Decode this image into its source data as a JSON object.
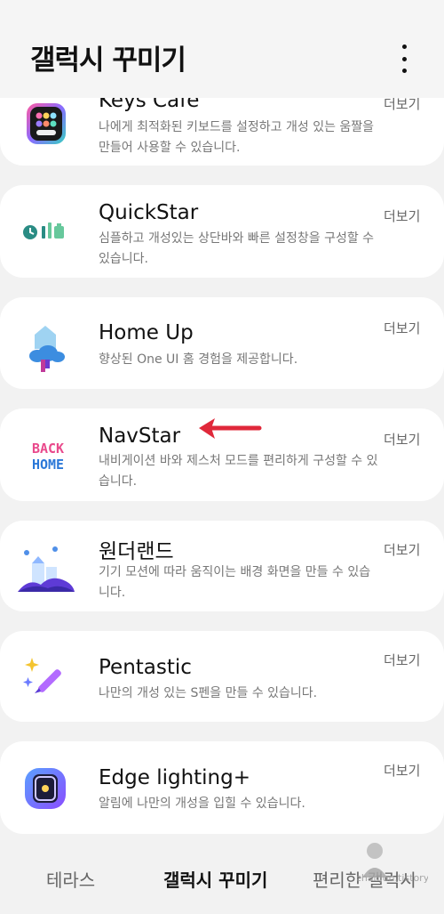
{
  "header": {
    "title": "갤럭시 꾸미기"
  },
  "items": [
    {
      "name": "Keys Cafe",
      "desc": "나에게 최적화된 키보드를 설정하고 개성 있는 움짤을 만들어 사용할 수 있습니다.",
      "more": "더보기",
      "icon": "keys-cafe-icon"
    },
    {
      "name": "QuickStar",
      "desc": "심플하고 개성있는 상단바와 빠른 설정창을 구성할 수 있습니다.",
      "more": "더보기",
      "icon": "quickstar-icon"
    },
    {
      "name": "Home Up",
      "desc": "향상된 One UI 홈 경험을 제공합니다.",
      "more": "더보기",
      "icon": "home-up-icon"
    },
    {
      "name": "NavStar",
      "desc": "내비게이션 바와 제스처 모드를 편리하게 구성할 수 있습니다.",
      "more": "더보기",
      "icon": "navstar-icon",
      "icon_text": [
        "BACK",
        "HOME"
      ]
    },
    {
      "name": "원더랜드",
      "desc": "기기 모션에 따라 움직이는 배경 화면을 만들 수 있습니다.",
      "more": "더보기",
      "icon": "wonderland-icon"
    },
    {
      "name": "Pentastic",
      "desc": "나만의 개성 있는 S펜을 만들 수 있습니다.",
      "more": "더보기",
      "icon": "pentastic-icon"
    },
    {
      "name": "Edge lighting+",
      "desc": "알림에 나만의 개성을 입힐 수 있습니다.",
      "more": "더보기",
      "icon": "edge-lighting-icon"
    }
  ],
  "tabs": [
    {
      "label": "테라스",
      "active": false
    },
    {
      "label": "갤럭시 꾸미기",
      "active": true
    },
    {
      "label": "편리한 갤럭시",
      "active": false
    }
  ],
  "annotation": {
    "icon": "red-arrow-icon",
    "color": "#e0283a"
  },
  "watermark": {
    "text": "chanjun.tistory"
  }
}
